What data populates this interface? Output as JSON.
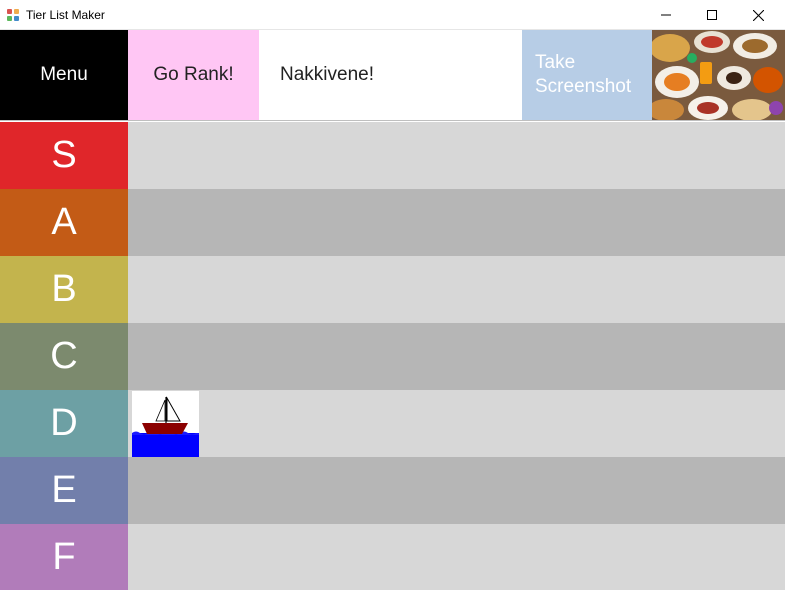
{
  "window": {
    "title": "Tier List Maker",
    "icons": [
      "app-grid-icon",
      "minimize-icon",
      "maximize-icon",
      "close-icon"
    ]
  },
  "header": {
    "menu_label": "Menu",
    "go_rank_label": "Go Rank!",
    "list_title": "Nakkivene!",
    "screenshot_label_line1": "Take",
    "screenshot_label_line2": "Screenshot",
    "colors": {
      "menu": "#000000",
      "go_rank": "#ffc6f4",
      "screenshot": "#b7cde6"
    }
  },
  "tiers": [
    {
      "label": "S",
      "color": "#e0262a",
      "items": []
    },
    {
      "label": "A",
      "color": "#c35b16",
      "items": []
    },
    {
      "label": "B",
      "color": "#c3b44d",
      "items": []
    },
    {
      "label": "C",
      "color": "#7c8a6e",
      "items": []
    },
    {
      "label": "D",
      "color": "#6da0a4",
      "items": [
        "sailboat-image"
      ]
    },
    {
      "label": "E",
      "color": "#727fab",
      "items": []
    },
    {
      "label": "F",
      "color": "#b17cba",
      "items": []
    }
  ]
}
